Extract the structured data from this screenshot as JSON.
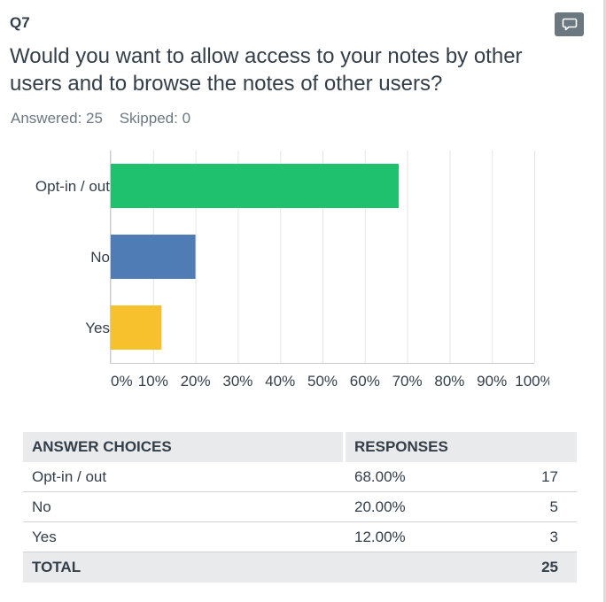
{
  "question": {
    "number": "Q7",
    "title": "Would you want to allow access to your notes by other users and to browse the notes of other users?",
    "answered_label": "Answered: 25",
    "skipped_label": "Skipped: 0"
  },
  "chart_data": {
    "type": "bar",
    "orientation": "horizontal",
    "categories": [
      "Opt-in / out",
      "No",
      "Yes"
    ],
    "values": [
      68,
      20,
      12
    ],
    "colors": [
      "#1fc16f",
      "#507cb6",
      "#f7c12e"
    ],
    "xlim": [
      0,
      100
    ],
    "xticks": [
      "0%",
      "10%",
      "20%",
      "30%",
      "40%",
      "50%",
      "60%",
      "70%",
      "80%",
      "90%",
      "100%"
    ],
    "grid": true,
    "title": "",
    "xlabel": "",
    "ylabel": ""
  },
  "table": {
    "headers": [
      "ANSWER CHOICES",
      "RESPONSES"
    ],
    "rows": [
      {
        "choice": "Opt-in / out",
        "percent": "68.00%",
        "count": "17"
      },
      {
        "choice": "No",
        "percent": "20.00%",
        "count": "5"
      },
      {
        "choice": "Yes",
        "percent": "12.00%",
        "count": "3"
      }
    ],
    "total_label": "TOTAL",
    "total_value": "25"
  },
  "icons": {
    "comment": "comment-icon"
  },
  "colors": {
    "text": "#333e48",
    "muted": "#6b787f",
    "header_bg": "#e9eaeb"
  }
}
